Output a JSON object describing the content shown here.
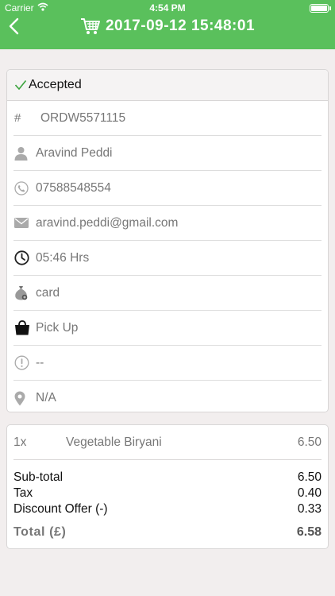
{
  "status_bar": {
    "carrier": "Carrier",
    "time": "4:54 PM"
  },
  "nav": {
    "title": "2017-09-12 15:48:01",
    "back_icon": "chevron-left-icon",
    "title_icon": "cart-icon"
  },
  "order": {
    "status": "Accepted",
    "number_prefix": "#",
    "number": "ORDW5571115",
    "customer_name": "Aravind Peddi",
    "phone": "07588548554",
    "email": "aravind.peddi@gmail.com",
    "time": "05:46 Hrs",
    "payment": "card",
    "delivery_type": "Pick Up",
    "note": "--",
    "address": "N/A"
  },
  "items": [
    {
      "qty": "1x",
      "name": "Vegetable Biryani",
      "price": "6.50"
    }
  ],
  "summary": {
    "subtotal_label": "Sub-total",
    "subtotal": "6.50",
    "tax_label": "Tax",
    "tax": "0.40",
    "discount_label": "Discount Offer (-)",
    "discount": "0.33",
    "total_label": "Total (£)",
    "total": "6.58"
  },
  "colors": {
    "header": "#5ac05c",
    "accent_check": "#3aa33c"
  }
}
